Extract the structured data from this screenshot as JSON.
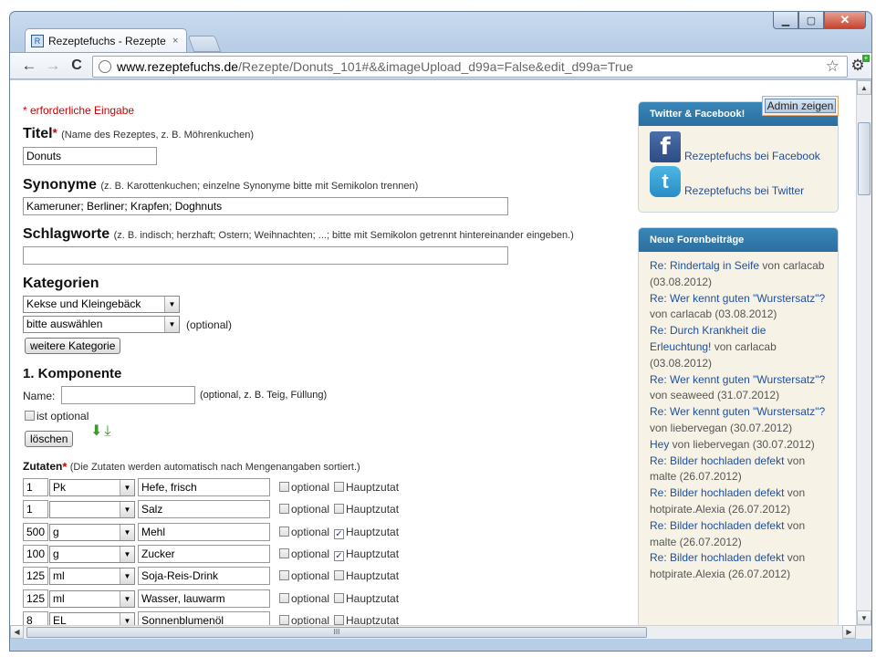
{
  "tab": {
    "title": "Rezeptefuchs - Rezepte mi",
    "close": "×"
  },
  "nav": {
    "back": "←",
    "forward": "→",
    "reload": "C",
    "star": "☆",
    "wrench": "🔧"
  },
  "url": {
    "host": "www.rezeptefuchs.de",
    "path": "/Rezepte/Donuts_101#&&imageUpload_d99a=False&edit_d99a=True"
  },
  "form": {
    "required_note": "* erforderliche Eingabe",
    "title": {
      "label": "Titel",
      "star": "*",
      "hint": "(Name des Rezeptes, z. B. Möhrenkuchen)",
      "value": "Donuts"
    },
    "synonyms": {
      "label": "Synonyme",
      "hint": "(z. B. Karottenkuchen; einzelne Synonyme bitte mit Semikolon trennen)",
      "value": "Kameruner; Berliner; Krapfen; Doghnuts"
    },
    "tags": {
      "label": "Schlagworte",
      "hint": "(z. B. indisch; herzhaft; Ostern; Weihnachten; ...; bitte mit Semikolon getrennt hintereinander eingeben.)",
      "value": ""
    },
    "categories": {
      "label": "Kategorien",
      "first": "Kekse und Kleingebäck",
      "second": "bitte auswählen",
      "optional": "(optional)",
      "more_button": "weitere Kategorie"
    },
    "component": {
      "heading": "1. Komponente",
      "name_label": "Name:",
      "name_value": "",
      "name_hint": "(optional, z. B. Teig, Füllung)",
      "optional_label": "ist optional",
      "delete_button": "löschen"
    },
    "ingredients": {
      "label": "Zutaten",
      "star": "*",
      "hint": "(Die Zutaten werden automatisch nach Mengenangaben sortiert.)",
      "optional_label": "optional",
      "main_label": "Hauptzutat",
      "rows": [
        {
          "qty": "1",
          "unit": "Pk",
          "name": "Hefe, frisch",
          "main": false
        },
        {
          "qty": "1",
          "unit": "",
          "name": "Salz",
          "main": false
        },
        {
          "qty": "500",
          "unit": "g",
          "name": "Mehl",
          "main": true
        },
        {
          "qty": "100",
          "unit": "g",
          "name": "Zucker",
          "main": true
        },
        {
          "qty": "125",
          "unit": "ml",
          "name": "Soja-Reis-Drink",
          "main": false
        },
        {
          "qty": "125",
          "unit": "ml",
          "name": "Wasser, lauwarm",
          "main": false
        },
        {
          "qty": "8",
          "unit": "EL",
          "name": "Sonnenblumenöl",
          "main": false
        }
      ]
    }
  },
  "sidebar": {
    "admin_button": "Admin zeigen",
    "social": {
      "heading": "Twitter & Facebook!",
      "facebook": "Rezeptefuchs bei Facebook",
      "twitter": "Rezeptefuchs bei Twitter"
    },
    "forum": {
      "heading": "Neue Forenbeiträge",
      "posts": [
        {
          "title": "Re: Rindertalg in Seife",
          "by": " von carlacab (03.08.2012)"
        },
        {
          "title": "Re: Wer kennt guten \"Wurstersatz\"?",
          "by": " von carlacab (03.08.2012)"
        },
        {
          "title": "Re: Durch Krankheit die Erleuchtung!",
          "by": " von carlacab (03.08.2012)"
        },
        {
          "title": "Re: Wer kennt guten \"Wurstersatz\"?",
          "by": " von seaweed (31.07.2012)"
        },
        {
          "title": "Re: Wer kennt guten \"Wurstersatz\"?",
          "by": " von liebervegan (30.07.2012)"
        },
        {
          "title": "Hey",
          "by": " von liebervegan (30.07.2012)"
        },
        {
          "title": "Re: Bilder hochladen defekt",
          "by": " von malte (26.07.2012)"
        },
        {
          "title": "Re: Bilder hochladen defekt",
          "by": " von hotpirate.Alexia (26.07.2012)"
        },
        {
          "title": "Re: Bilder hochladen defekt",
          "by": " von malte (26.07.2012)"
        },
        {
          "title": "Re: Bilder hochladen defekt",
          "by": " von hotpirate.Alexia (26.07.2012)"
        }
      ]
    }
  },
  "scrollbar": {
    "grip": "III"
  }
}
